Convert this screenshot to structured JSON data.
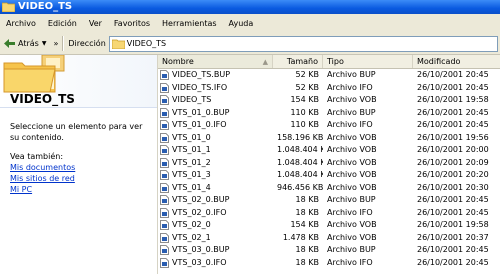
{
  "window": {
    "title": "VIDEO_TS"
  },
  "menu": [
    "Archivo",
    "Edición",
    "Ver",
    "Favoritos",
    "Herramientas",
    "Ayuda"
  ],
  "toolbar": {
    "back_label": "Atrás",
    "more": "»",
    "address_label": "Dirección",
    "address_value": "VIDEO_TS"
  },
  "taskpane": {
    "title": "VIDEO_TS",
    "description": "Seleccione un elemento para ver su contenido.",
    "see_also": "Vea también:",
    "links": [
      "Mis documentos",
      "Mis sitios de red",
      "Mi PC"
    ]
  },
  "columns": {
    "name": "Nombre",
    "size": "Tamaño",
    "type": "Tipo",
    "modified": "Modificado"
  },
  "files": [
    {
      "name": "VIDEO_TS.BUP",
      "size": "52 KB",
      "type": "Archivo BUP",
      "modified": "26/10/2001 20:45"
    },
    {
      "name": "VIDEO_TS.IFO",
      "size": "52 KB",
      "type": "Archivo IFO",
      "modified": "26/10/2001 20:45"
    },
    {
      "name": "VIDEO_TS",
      "size": "154 KB",
      "type": "Archivo VOB",
      "modified": "26/10/2001 19:58"
    },
    {
      "name": "VTS_01_0.BUP",
      "size": "110 KB",
      "type": "Archivo BUP",
      "modified": "26/10/2001 20:45"
    },
    {
      "name": "VTS_01_0.IFO",
      "size": "110 KB",
      "type": "Archivo IFO",
      "modified": "26/10/2001 20:45"
    },
    {
      "name": "VTS_01_0",
      "size": "158.196 KB",
      "type": "Archivo VOB",
      "modified": "26/10/2001 19:56"
    },
    {
      "name": "VTS_01_1",
      "size": "1.048.404 KB",
      "type": "Archivo VOB",
      "modified": "26/10/2001 20:00"
    },
    {
      "name": "VTS_01_2",
      "size": "1.048.404 KB",
      "type": "Archivo VOB",
      "modified": "26/10/2001 20:09"
    },
    {
      "name": "VTS_01_3",
      "size": "1.048.404 KB",
      "type": "Archivo VOB",
      "modified": "26/10/2001 20:20"
    },
    {
      "name": "VTS_01_4",
      "size": "946.456 KB",
      "type": "Archivo VOB",
      "modified": "26/10/2001 20:30"
    },
    {
      "name": "VTS_02_0.BUP",
      "size": "18 KB",
      "type": "Archivo BUP",
      "modified": "26/10/2001 20:45"
    },
    {
      "name": "VTS_02_0.IFO",
      "size": "18 KB",
      "type": "Archivo IFO",
      "modified": "26/10/2001 20:45"
    },
    {
      "name": "VTS_02_0",
      "size": "154 KB",
      "type": "Archivo VOB",
      "modified": "26/10/2001 19:58"
    },
    {
      "name": "VTS_02_1",
      "size": "1.478 KB",
      "type": "Archivo VOB",
      "modified": "26/10/2001 20:37"
    },
    {
      "name": "VTS_03_0.BUP",
      "size": "18 KB",
      "type": "Archivo BUP",
      "modified": "26/10/2001 20:45"
    },
    {
      "name": "VTS_03_0.IFO",
      "size": "18 KB",
      "type": "Archivo IFO",
      "modified": "26/10/2001 20:45"
    }
  ]
}
